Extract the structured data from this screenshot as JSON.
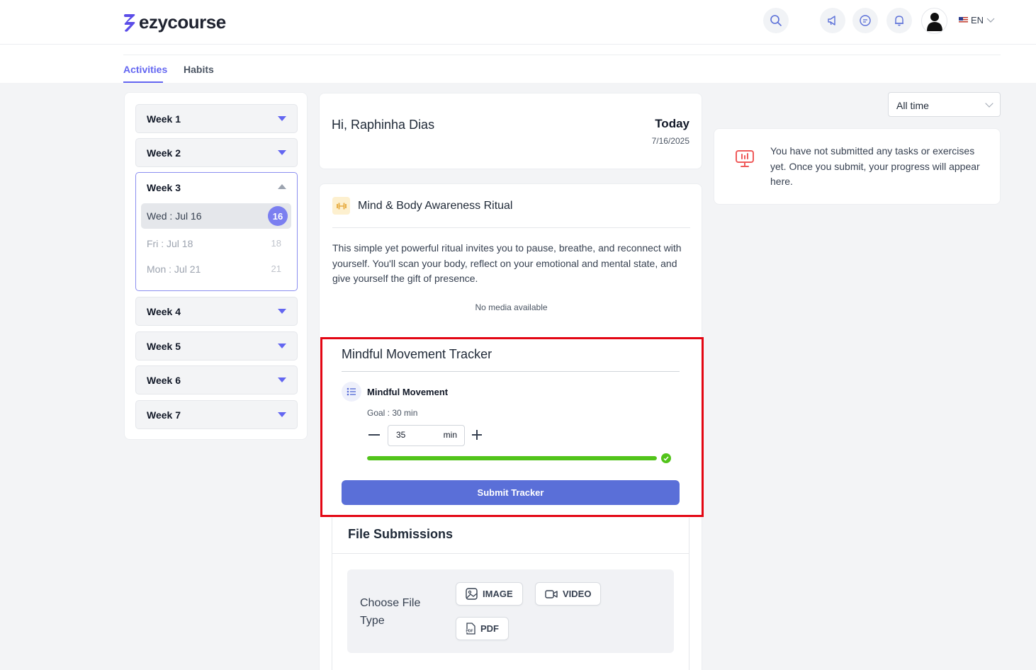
{
  "header": {
    "brand": "ezycourse",
    "language": "EN",
    "icons": [
      "search-icon",
      "megaphone-icon",
      "chat-icon",
      "bell-icon",
      "user-avatar"
    ]
  },
  "tabs": [
    {
      "label": "Activities",
      "active": true
    },
    {
      "label": "Habits",
      "active": false
    }
  ],
  "weeks": {
    "week1": "Week 1",
    "week2": "Week 2",
    "week3": "Week 3",
    "week4": "Week 4",
    "week5": "Week 5",
    "week6": "Week 6",
    "week7": "Week 7"
  },
  "week3_days": [
    {
      "label": "Wed : Jul 16",
      "num": "16",
      "selected": true
    },
    {
      "label": "Fri : Jul 18",
      "num": "18",
      "selected": false
    },
    {
      "label": "Mon : Jul 21",
      "num": "21",
      "selected": false
    }
  ],
  "greeting": {
    "hi": "Hi, Raphinha Dias",
    "today_label": "Today",
    "date": "7/16/2025"
  },
  "activity": {
    "title": "Mind & Body Awareness Ritual",
    "description": "This simple yet powerful ritual invites you to pause, breathe, and reconnect with yourself. You'll scan your body, reflect on your emotional and mental state, and give yourself the gift of presence.",
    "no_media": "No media available"
  },
  "tracker": {
    "title": "Mindful Movement Tracker",
    "item_title": "Mindful Movement",
    "goal": "Goal : 30 min",
    "value": "35",
    "unit": "min",
    "progress_fraction": 1.0,
    "submit_label": "Submit Tracker"
  },
  "files": {
    "title": "File Submissions",
    "choose_label": "Choose File Type",
    "types": {
      "image": "IMAGE",
      "video": "VIDEO",
      "pdf": "PDF"
    }
  },
  "filter": {
    "selected": "All time"
  },
  "notice": {
    "text": "You have not submitted any tasks or exercises yet. Once you submit, your progress will appear here."
  },
  "colors": {
    "accent": "#6366f1",
    "submit": "#5a6fd8",
    "progress": "#52c41a",
    "highlight": "#e30613"
  }
}
